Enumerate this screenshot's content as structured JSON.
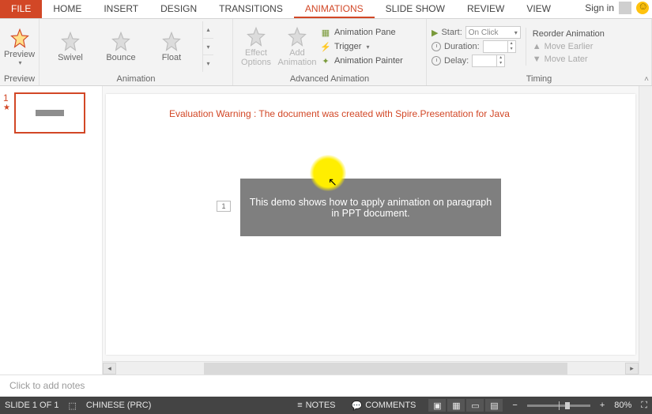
{
  "tabs": {
    "file": "FILE",
    "items": [
      "HOME",
      "INSERT",
      "DESIGN",
      "TRANSITIONS",
      "ANIMATIONS",
      "SLIDE SHOW",
      "REVIEW",
      "VIEW"
    ],
    "active_index": 4,
    "sign_in": "Sign in"
  },
  "ribbon": {
    "preview": {
      "label": "Preview",
      "group": "Preview"
    },
    "animation": {
      "items": [
        "Swivel",
        "Bounce",
        "Float"
      ],
      "group": "Animation"
    },
    "advanced": {
      "effect_options": "Effect\nOptions",
      "add_animation": "Add\nAnimation",
      "animation_pane": "Animation Pane",
      "trigger": "Trigger",
      "animation_painter": "Animation Painter",
      "group": "Advanced Animation"
    },
    "timing": {
      "start_label": "Start:",
      "start_value": "On Click",
      "duration_label": "Duration:",
      "delay_label": "Delay:",
      "reorder_header": "Reorder Animation",
      "move_earlier": "Move Earlier",
      "move_later": "Move Later",
      "group": "Timing"
    }
  },
  "thumb": {
    "number": "1",
    "star": "★"
  },
  "slide": {
    "warning": "Evaluation Warning : The document was created with Spire.Presentation for Java",
    "tag": "1",
    "shape_text": "This demo shows how to apply animation on paragraph in PPT document."
  },
  "notes": {
    "placeholder": "Click to add notes"
  },
  "status": {
    "slide": "SLIDE 1 OF 1",
    "lang": "CHINESE (PRC)",
    "notes": "NOTES",
    "comments": "COMMENTS",
    "zoom": "80%"
  }
}
